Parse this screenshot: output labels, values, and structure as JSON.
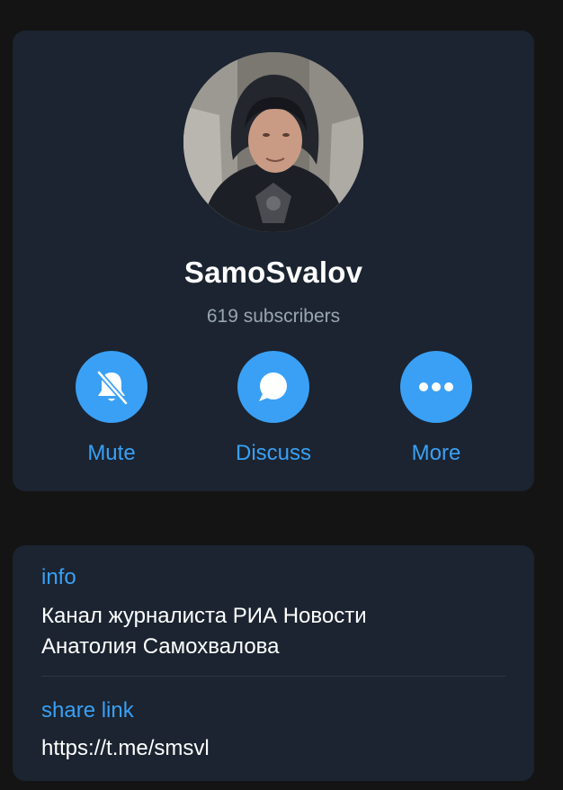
{
  "profile": {
    "name": "SamoSvalov",
    "subscribers": "619 subscribers",
    "avatar_description": "avatar photo"
  },
  "actions": [
    {
      "label": "Mute",
      "icon": "bell-slash-icon"
    },
    {
      "label": "Discuss",
      "icon": "chat-bubble-icon"
    },
    {
      "label": "More",
      "icon": "more-dots-icon"
    }
  ],
  "info": {
    "label": "info",
    "line1": "Канал журналиста РИА Новости",
    "line2": "Анатолия Самохвалова"
  },
  "share_link": {
    "label": "share link",
    "url": "https://t.me/smsvl"
  },
  "colors": {
    "background": "#141414",
    "card": "#1b2430",
    "accent": "#3aa0f5",
    "secondary_text": "#9aa5b2"
  }
}
